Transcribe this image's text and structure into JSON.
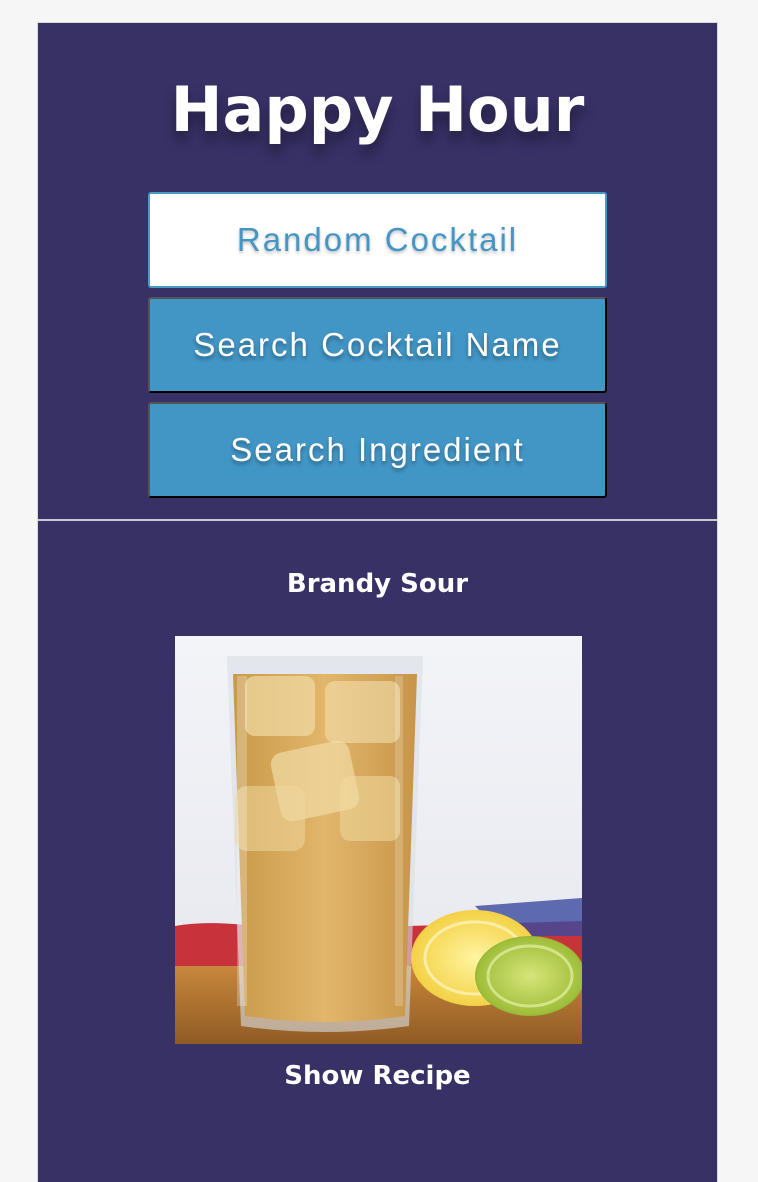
{
  "header": {
    "title": "Happy Hour",
    "buttons": {
      "random": "Random Cocktail",
      "search_name": "Search Cocktail Name",
      "search_ingredient": "Search Ingredient"
    }
  },
  "result": {
    "drink_name": "Brandy Sour",
    "show_recipe": "Show Recipe"
  },
  "colors": {
    "background": "#373166",
    "button_blue": "#4296c6",
    "random_text": "#4596c5"
  }
}
